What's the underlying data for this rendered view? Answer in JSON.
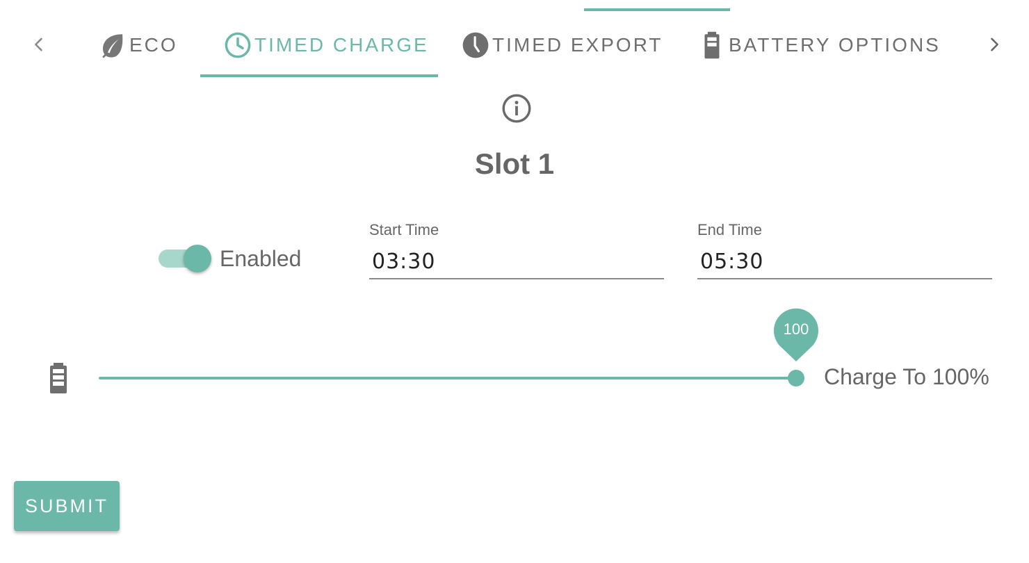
{
  "tabs": [
    {
      "label": "ECO",
      "icon": "leaf-icon",
      "active": false
    },
    {
      "label": "TIMED CHARGE",
      "icon": "clock-outline-icon",
      "active": true
    },
    {
      "label": "TIMED EXPORT",
      "icon": "clock-filled-icon",
      "active": false
    },
    {
      "label": "BATTERY OPTIONS",
      "icon": "battery-icon",
      "active": false
    }
  ],
  "nav": {
    "prev_icon": "chevron-left-icon",
    "next_icon": "chevron-right-icon"
  },
  "info_icon": "info-icon",
  "slot": {
    "title": "Slot 1",
    "enabled_label": "Enabled",
    "enabled": true,
    "start_time": {
      "label": "Start Time",
      "value": "03:30"
    },
    "end_time": {
      "label": "End Time",
      "value": "05:30"
    },
    "charge": {
      "icon": "battery-icon",
      "value": 100,
      "min": 0,
      "max": 100,
      "bubble": "100",
      "label": "Charge To 100%"
    }
  },
  "submit_label": "SUBMIT",
  "colors": {
    "accent": "#6bb8a8",
    "accent_light": "#a7d6cb",
    "text": "#666666"
  }
}
